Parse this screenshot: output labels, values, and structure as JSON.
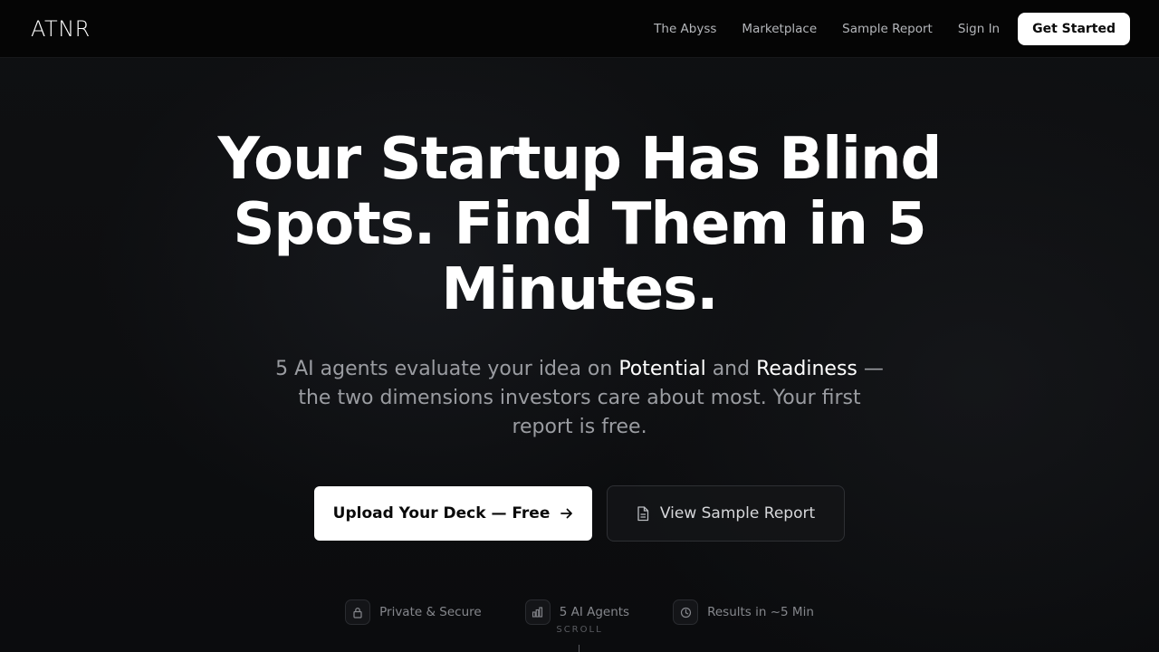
{
  "nav": {
    "logo": "ATNR",
    "links": [
      "The Abyss",
      "Marketplace",
      "Sample Report",
      "Sign In"
    ],
    "cta": "Get Started"
  },
  "hero": {
    "title": "Your Startup Has Blind Spots. Find Them in 5 Minutes.",
    "subtitle_parts": {
      "part1": "5 AI agents evaluate your idea on ",
      "highlight1": "Potential",
      "part2": " and ",
      "highlight2": "Readiness",
      "part3": " — the two dimensions investors care about most. Your first report is free."
    },
    "primary_cta": "Upload Your Deck — Free",
    "primary_cta_icon": "arrow-right-icon",
    "secondary_cta": "View Sample Report",
    "secondary_cta_icon": "document-icon"
  },
  "badges": [
    {
      "label": "Private & Secure",
      "icon": "lock-icon"
    },
    {
      "label": "5 AI Agents",
      "icon": "bar-chart-icon"
    },
    {
      "label": "Results in ~5 Min",
      "icon": "clock-icon"
    }
  ],
  "scroll_hint": "SCROLL",
  "colors": {
    "background": "#0c0d0f",
    "nav_background": "#050505",
    "primary_button": "#ffffff",
    "muted_text": "#9a9ca1"
  }
}
